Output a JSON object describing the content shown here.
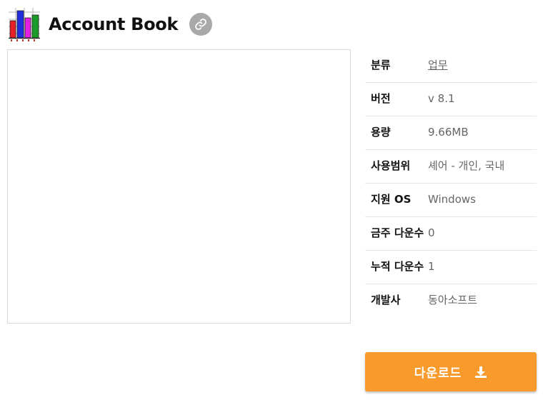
{
  "header": {
    "title": "Account Book",
    "app_icon": "bar-chart-icon",
    "link_icon": "link-icon"
  },
  "info": {
    "category_label": "분류",
    "category_value": "업무",
    "version_label": "버전",
    "version_value": "v 8.1",
    "size_label": "용량",
    "size_value": "9.66MB",
    "license_label": "사용범위",
    "license_value": "셰어 - 개인, 국내",
    "os_label": "지원 OS",
    "os_value": "Windows",
    "weekly_label": "금주 다운수",
    "weekly_value": "0",
    "total_label": "누적 다운수",
    "total_value": "1",
    "developer_label": "개발사",
    "developer_value": "동아소프트"
  },
  "download": {
    "label": "다운로드",
    "icon": "download-icon"
  },
  "colors": {
    "accent": "#f89b2c",
    "link_button": "#a9a9a9"
  }
}
